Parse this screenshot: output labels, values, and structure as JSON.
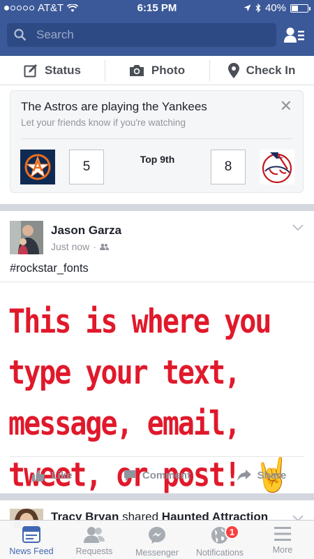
{
  "status_bar": {
    "carrier": "AT&T",
    "time": "6:15 PM",
    "battery": "40%",
    "battery_level": 0.4
  },
  "search": {
    "placeholder": "Search"
  },
  "composer": {
    "status_label": "Status",
    "photo_label": "Photo",
    "checkin_label": "Check In"
  },
  "scorecard": {
    "title": "The Astros are playing the Yankees",
    "subtitle": "Let your friends know if you're watching",
    "home_score": "5",
    "inning": "Top 9th",
    "away_score": "8",
    "close_symbol": "✕"
  },
  "post": {
    "author": "Jason Garza",
    "time": "Just now",
    "text": "#rockstar_fonts",
    "big_text": "This is where you type your text, message, email, tweet, or post! 🤘",
    "actions": {
      "like": "Like",
      "comment": "Comment",
      "share": "Share"
    }
  },
  "post2": {
    "author": "Tracy Bryan",
    "verb": "shared",
    "target": "Haunted Attraction"
  },
  "tabbar": {
    "tabs": [
      {
        "label": "News Feed",
        "icon": "news-feed-icon",
        "active": true
      },
      {
        "label": "Requests",
        "icon": "friend-requests-icon"
      },
      {
        "label": "Messenger",
        "icon": "messenger-icon"
      },
      {
        "label": "Notifications",
        "icon": "globe-icon",
        "badge": "1"
      },
      {
        "label": "More",
        "icon": "menu-icon"
      }
    ]
  },
  "colors": {
    "brand": "#3b5998",
    "accent": "#4267b2",
    "badge": "#fa3e3e",
    "font_text": "#e0192b"
  }
}
